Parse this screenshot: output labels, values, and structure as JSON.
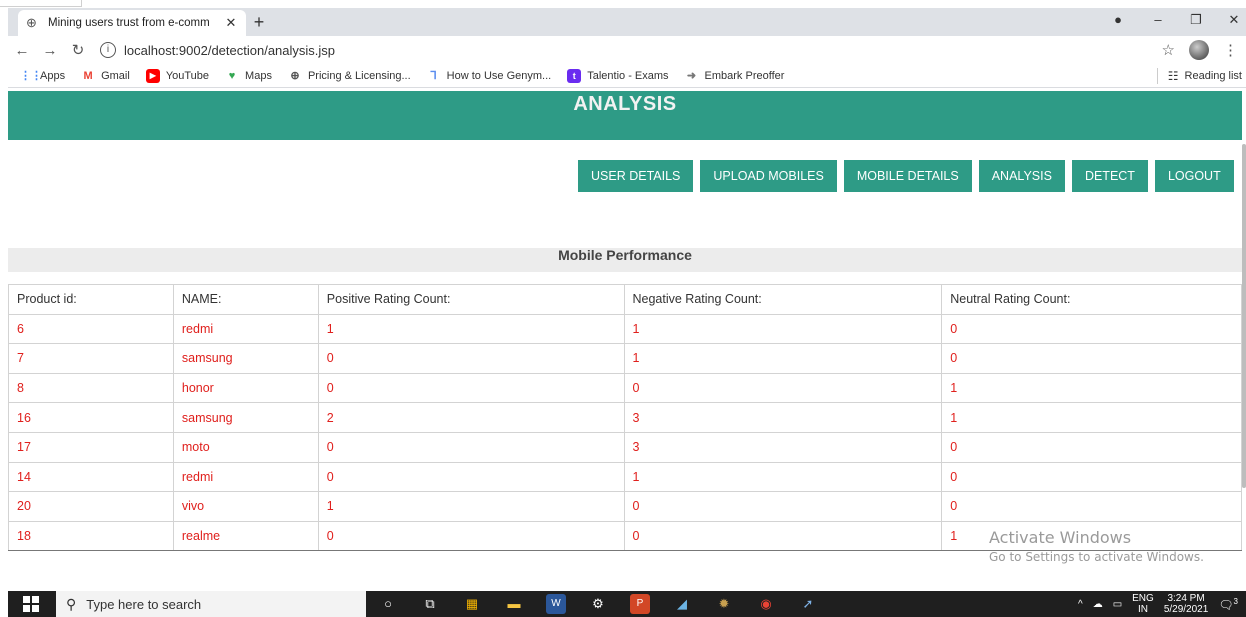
{
  "browser": {
    "tab_title": "Mining users trust from e-comm",
    "new_tab": "+",
    "url": "localhost:9002/detection/analysis.jsp",
    "bookmarks": [
      {
        "label": "Apps",
        "icon": "apps-grid-icon",
        "color": "#4285f4"
      },
      {
        "label": "Gmail",
        "icon": "gmail-icon",
        "color": "#ea4335"
      },
      {
        "label": "YouTube",
        "icon": "youtube-icon",
        "color": "#ff0000"
      },
      {
        "label": "Maps",
        "icon": "maps-pin-icon",
        "color": "#34a853"
      },
      {
        "label": "Pricing & Licensing...",
        "icon": "globe-icon",
        "color": "#555555"
      },
      {
        "label": "How to Use Genym...",
        "icon": "genymotion-icon",
        "color": "#5b8def"
      },
      {
        "label": "Talentio - Exams",
        "icon": "talentio-icon",
        "color": "#6a2cf0"
      },
      {
        "label": "Embark Preoffer",
        "icon": "embark-icon",
        "color": "#777777"
      }
    ],
    "reading_list": "Reading list"
  },
  "page": {
    "banner_title": "ANALYSIS",
    "accent_color": "#2e9b86",
    "menu": [
      "USER DETAILS",
      "UPLOAD MOBILES",
      "MOBILE DETAILS",
      "ANALYSIS",
      "DETECT",
      "LOGOUT"
    ],
    "section_title": "Mobile Performance",
    "table": {
      "headers": [
        "Product id:",
        "NAME:",
        "Positive Rating Count:",
        "Negative Rating Count:",
        "Neutral Rating Count:"
      ],
      "rows": [
        [
          "6",
          "redmi",
          "1",
          "1",
          "0"
        ],
        [
          "7",
          "samsung",
          "0",
          "1",
          "0"
        ],
        [
          "8",
          "honor",
          "0",
          "0",
          "1"
        ],
        [
          "16",
          "samsung",
          "2",
          "3",
          "1"
        ],
        [
          "17",
          "moto",
          "0",
          "3",
          "0"
        ],
        [
          "14",
          "redmi",
          "0",
          "1",
          "0"
        ],
        [
          "20",
          "vivo",
          "1",
          "0",
          "0"
        ],
        [
          "18",
          "realme",
          "0",
          "0",
          "1"
        ]
      ]
    },
    "watermark": {
      "line1": "Activate Windows",
      "line2": "Go to Settings to activate Windows."
    }
  },
  "taskbar": {
    "search_placeholder": "Type here to search",
    "lang": "ENG",
    "region": "IN",
    "time": "3:24 PM",
    "date": "5/29/2021",
    "notification_count": "3"
  }
}
